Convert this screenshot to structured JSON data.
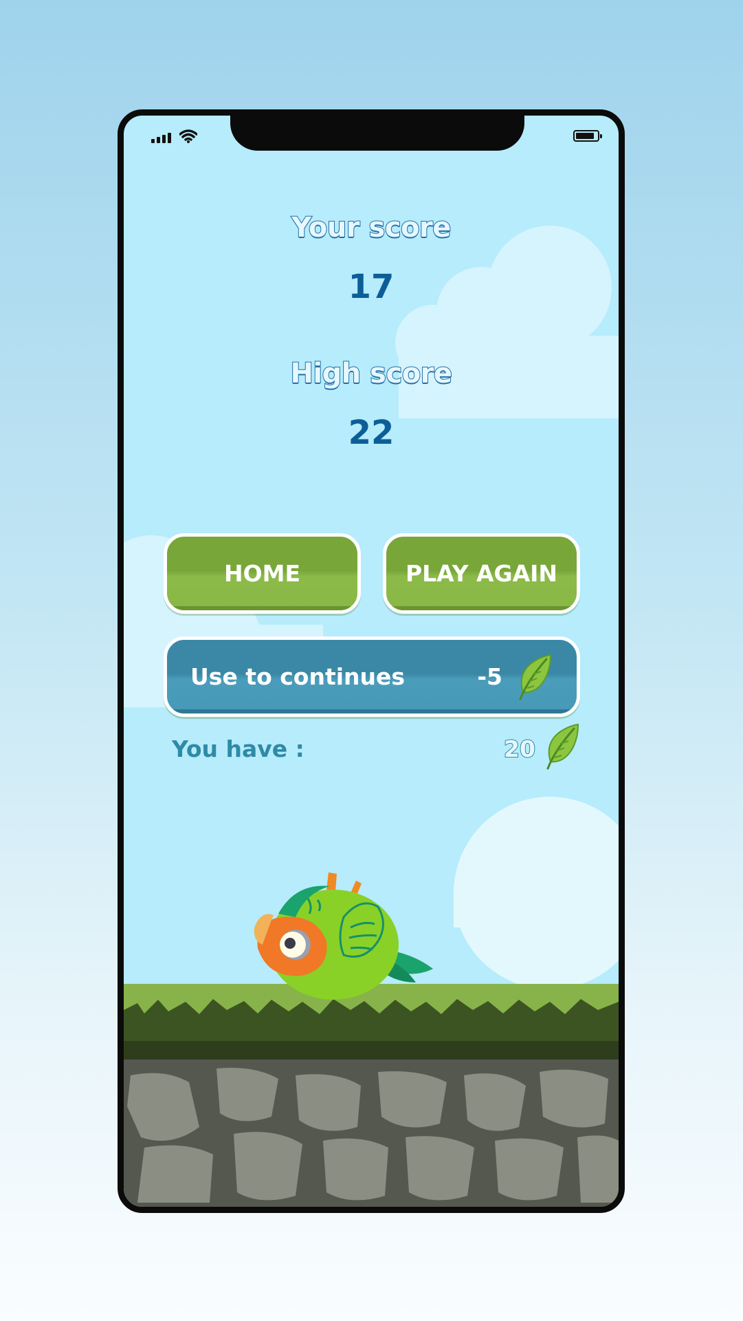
{
  "game_over": {
    "your_score_label": "Your score",
    "your_score_value": "17",
    "high_score_label": "High score",
    "high_score_value": "22"
  },
  "buttons": {
    "home_label": "HOME",
    "play_again_label": "PLAY AGAIN",
    "continue_label": "Use to continues",
    "continue_cost": "-5"
  },
  "wallet": {
    "label": "You have :",
    "balance": "20",
    "currency_icon": "leaf-icon"
  },
  "colors": {
    "sky": "#b6ecfb",
    "title_stroke": "#1f6fa8",
    "score_value": "#0c5e97",
    "green_button": "#78a639",
    "blue_button": "#3a88a6",
    "grass": "#87b34a",
    "rock": "#8a8d82"
  }
}
